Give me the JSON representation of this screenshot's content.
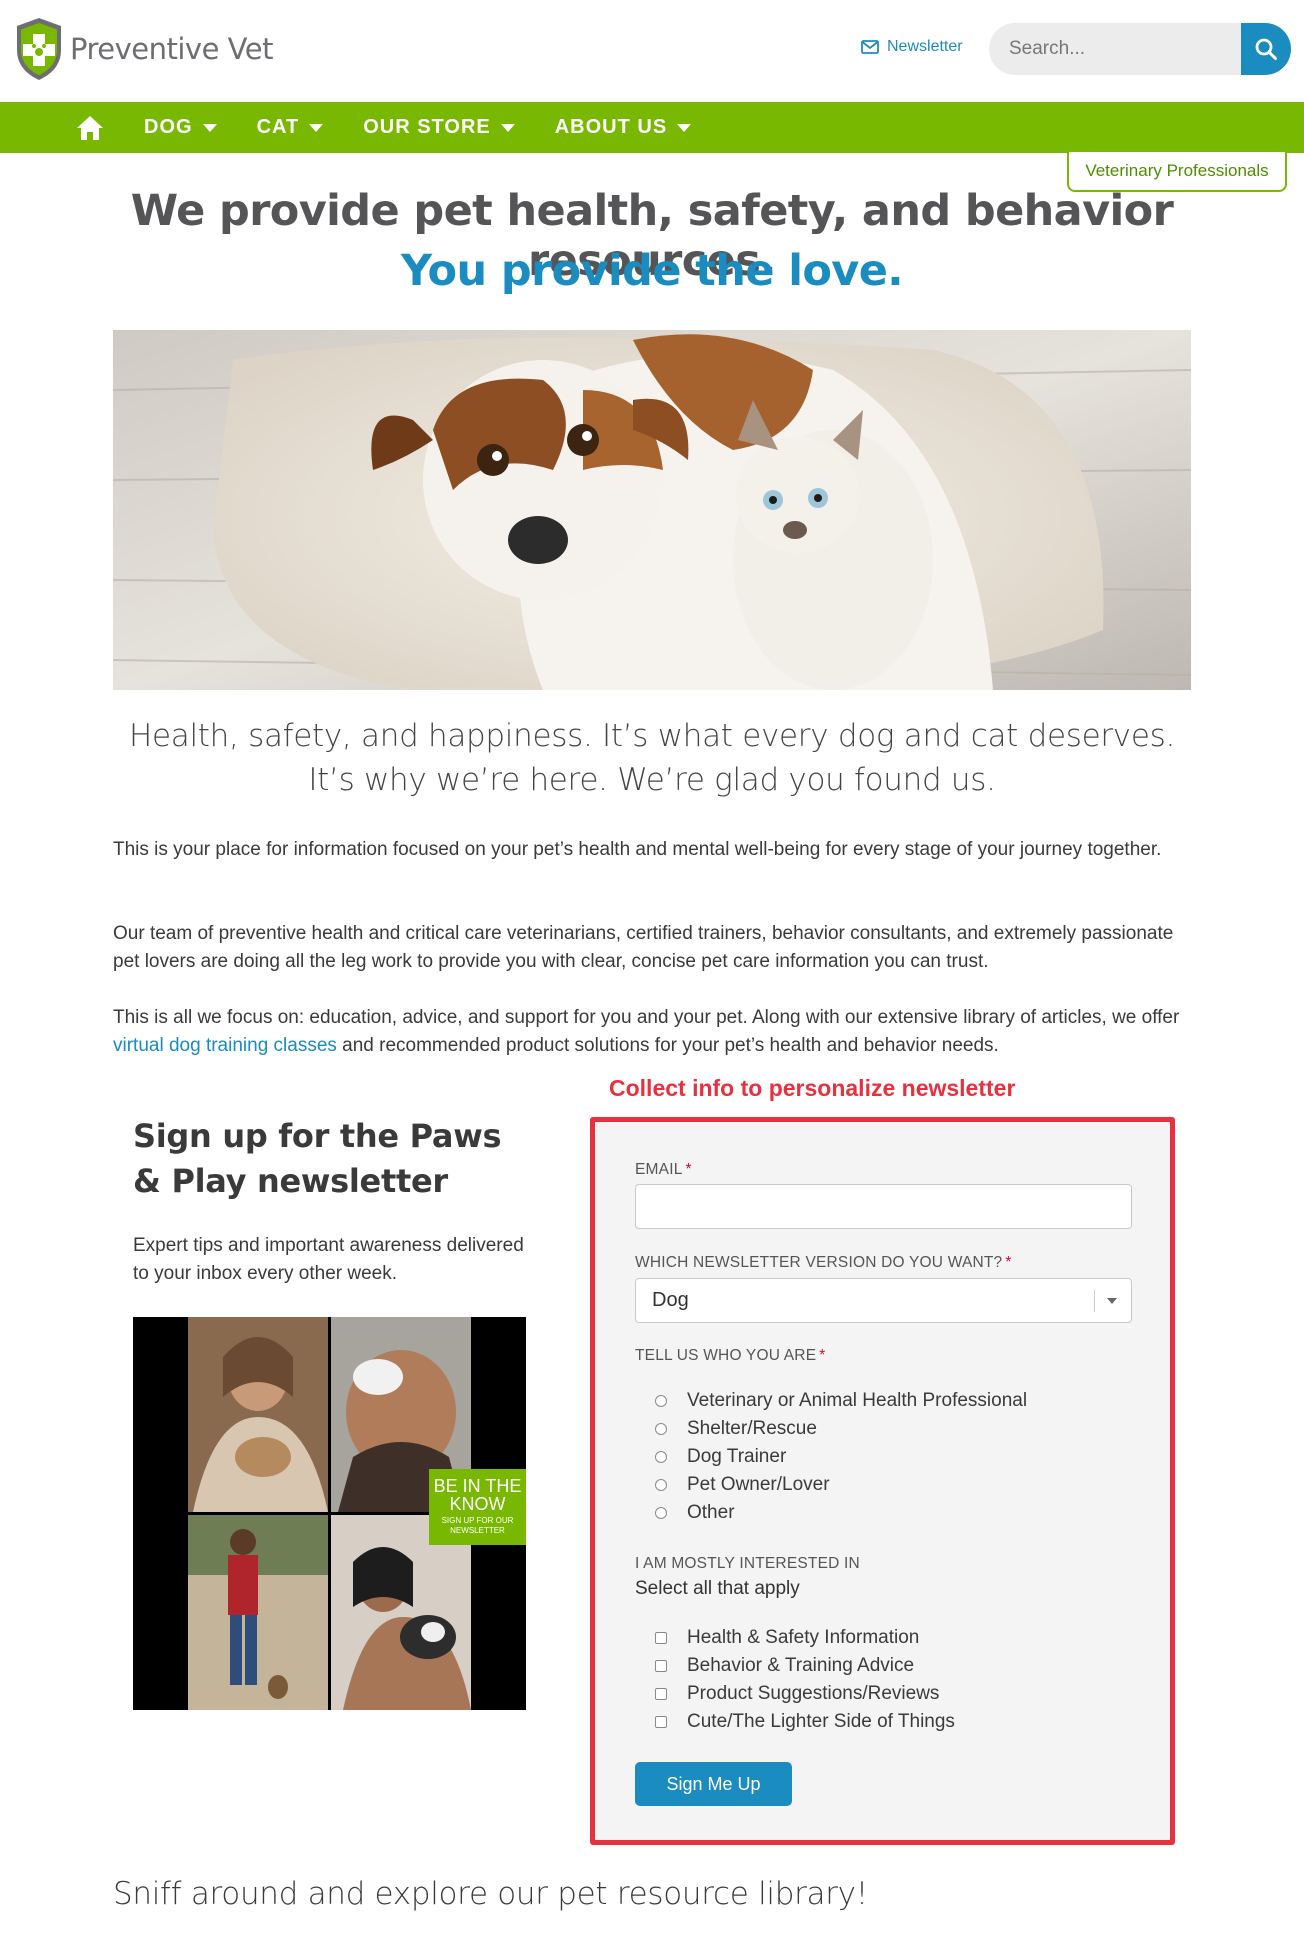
{
  "header": {
    "brand": "Preventive Vet",
    "newsletter_link": "Newsletter",
    "search_placeholder": "Search..."
  },
  "nav": {
    "items": [
      {
        "label": "DOG"
      },
      {
        "label": "CAT"
      },
      {
        "label": "OUR STORE"
      },
      {
        "label": "ABOUT US"
      }
    ],
    "vet_professionals": "Veterinary Professionals"
  },
  "hero": {
    "line1": "We provide pet health, safety, and behavior resources.",
    "line2": "You provide the love."
  },
  "tagline": {
    "line1": "Health, safety, and happiness. It’s what every dog and cat deserves.",
    "line2": "It’s why we’re here. We’re glad you found us."
  },
  "paragraphs": {
    "p1": "This is your place for information focused on your pet’s health and mental well-being for every stage of your journey together.",
    "p2": "Our team of preventive health and critical care veterinarians, certified trainers, behavior consultants, and extremely passionate pet lovers are doing all the leg work to provide you with clear, concise pet care information you can trust.",
    "p3_before": "This is all we focus on: education, advice, and support for you and your pet. Along with our extensive library of articles, we offer ",
    "p3_link": "virtual dog training classes",
    "p3_after": " and recommended product solutions for your pet’s health and behavior needs."
  },
  "newsletter": {
    "title": "Sign up for the Paws & Play newsletter",
    "description": "Expert tips and important awareness delivered to your inbox every other week.",
    "badge_line1": "BE IN THE",
    "badge_line2": "KNOW",
    "badge_small1": "SIGN UP FOR OUR",
    "badge_small2": "NEWSLETTER"
  },
  "annotation": "Collect info to personalize newsletter",
  "form": {
    "email_label": "EMAIL",
    "email_value": "",
    "version_label": "WHICH NEWSLETTER VERSION DO YOU WANT?",
    "version_value": "Dog",
    "who_label": "TELL US WHO YOU ARE",
    "who_options": [
      "Veterinary or Animal Health Professional",
      "Shelter/Rescue",
      "Dog Trainer",
      "Pet Owner/Lover",
      "Other"
    ],
    "interest_label": "I AM MOSTLY INTERESTED IN",
    "interest_hint": "Select all that apply",
    "interest_options": [
      "Health & Safety Information",
      "Behavior & Training Advice",
      "Product Suggestions/Reviews",
      "Cute/The Lighter Side of Things"
    ],
    "required_mark": "*",
    "submit": "Sign Me Up"
  },
  "footer_heading": "Sniff around and explore our pet resource library!",
  "colors": {
    "brand_green": "#79b800",
    "brand_blue": "#1a8cbf",
    "annotation_red": "#e8313f"
  }
}
